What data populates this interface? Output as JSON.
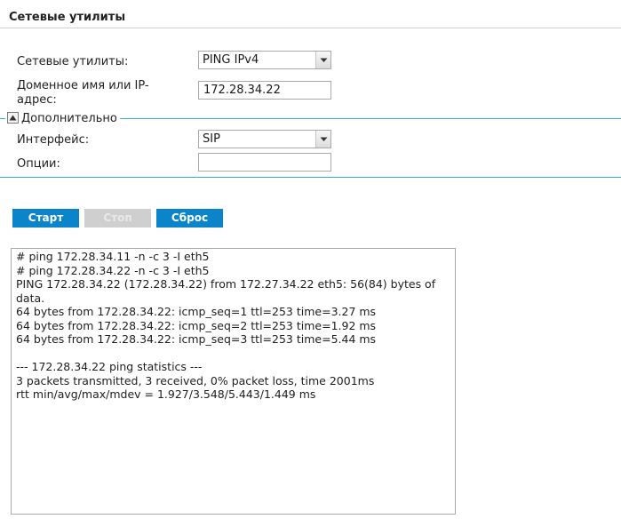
{
  "page": {
    "title": "Сетевые утилиты"
  },
  "form": {
    "utility_label": "Сетевые утилиты:",
    "utility_value": "PING IPv4",
    "host_label": "Доменное имя или IP-адрес:",
    "host_value": "172.28.34.22"
  },
  "advanced": {
    "toggle_label": "Дополнительно",
    "interface_label": "Интерфейс:",
    "interface_value": "SIP",
    "options_label": "Опции:",
    "options_value": ""
  },
  "buttons": {
    "start": "Старт",
    "stop": "Стоп",
    "reset": "Сброс"
  },
  "output": {
    "lines": [
      "# ping 172.28.34.11 -n -c 3 -I eth5",
      "# ping 172.28.34.22 -n -c 3 -I eth5",
      "PING 172.28.34.22 (172.28.34.22) from 172.27.34.22 eth5: 56(84) bytes of data.",
      "64 bytes from 172.28.34.22: icmp_seq=1 ttl=253 time=3.27 ms",
      "64 bytes from 172.28.34.22: icmp_seq=2 ttl=253 time=1.92 ms",
      "64 bytes from 172.28.34.22: icmp_seq=3 ttl=253 time=5.44 ms",
      "",
      "--- 172.28.34.22 ping statistics ---",
      "3 packets transmitted, 3 received, 0% packet loss, time 2001ms",
      "rtt min/avg/max/mdev = 1.927/3.548/5.443/1.449 ms"
    ]
  },
  "colors": {
    "accent": "#0b84c9",
    "section_line": "#3aaec9"
  },
  "icons": {
    "select_arrow": "chevron-down-icon",
    "collapse_toggle": "triangle-up-icon"
  }
}
